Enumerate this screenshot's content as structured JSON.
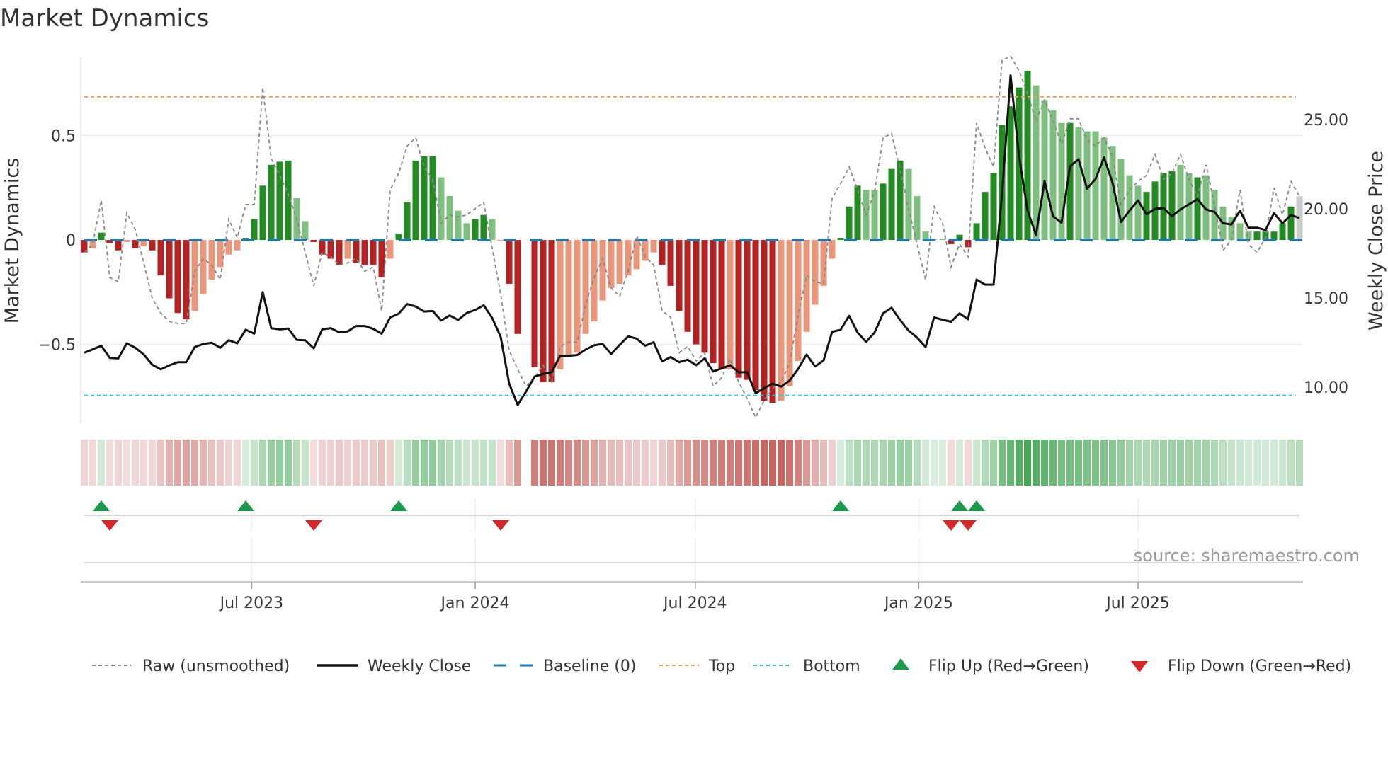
{
  "chart_data": {
    "type": "bar",
    "title": "Market Dynamics",
    "ylabel": "Market Dynamics",
    "y2label": "Weekly Close Price",
    "ylim": [
      -0.88,
      0.9
    ],
    "y2lim": [
      8.6,
      29.2
    ],
    "yticks": [
      {
        "value": 0.5,
        "label": "0.5"
      },
      {
        "value": 0,
        "label": "0"
      },
      {
        "value": -0.5,
        "label": "−0.5"
      }
    ],
    "y2ticks": [
      {
        "value": 25,
        "label": "25.00"
      },
      {
        "value": 20,
        "label": "20.00"
      },
      {
        "value": 15,
        "label": "15.00"
      },
      {
        "value": 10,
        "label": "10.00"
      }
    ],
    "xticks": [
      {
        "week": 20.7,
        "label": "Jul 2023"
      },
      {
        "week": 47.0,
        "label": "Jan 2024"
      },
      {
        "week": 72.9,
        "label": "Jul 2024"
      },
      {
        "week": 99.2,
        "label": "Jan 2025"
      },
      {
        "week": 125.0,
        "label": "Jul 2025"
      }
    ],
    "x_unit": "week index",
    "top_level": 0.685,
    "bottom_level": -0.745,
    "baseline": 0,
    "values": [
      -0.06,
      -0.04,
      0.035,
      -0.015,
      -0.05,
      -0.01,
      -0.04,
      -0.03,
      -0.05,
      -0.17,
      -0.28,
      -0.35,
      -0.38,
      -0.34,
      -0.26,
      -0.19,
      -0.13,
      -0.07,
      -0.05,
      0.01,
      0.1,
      0.26,
      0.36,
      0.375,
      0.38,
      0.2,
      0.09,
      -0.01,
      -0.07,
      -0.09,
      -0.12,
      -0.09,
      -0.11,
      -0.12,
      -0.12,
      -0.18,
      -0.09,
      0.03,
      0.18,
      0.38,
      0.4,
      0.4,
      0.3,
      0.21,
      0.14,
      0.08,
      0.1,
      0.12,
      0.1,
      -0.005,
      -0.21,
      -0.45,
      null,
      -0.61,
      -0.68,
      -0.68,
      -0.62,
      -0.56,
      -0.54,
      -0.45,
      -0.39,
      -0.29,
      -0.23,
      -0.21,
      -0.17,
      -0.14,
      -0.1,
      -0.06,
      -0.12,
      -0.22,
      -0.34,
      -0.44,
      -0.5,
      -0.54,
      -0.59,
      -0.62,
      -0.62,
      -0.66,
      -0.67,
      -0.72,
      -0.77,
      -0.78,
      -0.77,
      -0.7,
      -0.58,
      -0.44,
      -0.31,
      -0.22,
      -0.09,
      0.01,
      0.16,
      0.26,
      0.24,
      0.24,
      0.27,
      0.34,
      0.38,
      0.34,
      0.21,
      0.04,
      0.005,
      0.005,
      -0.02,
      0.025,
      -0.035,
      0.08,
      0.23,
      0.32,
      0.55,
      0.64,
      0.73,
      0.81,
      0.74,
      0.67,
      0.62,
      0.56,
      0.56,
      0.54,
      0.52,
      0.52,
      0.49,
      0.45,
      0.39,
      0.31,
      0.26,
      0.23,
      0.28,
      0.32,
      0.33,
      0.36,
      0.32,
      0.3,
      0.31,
      0.24,
      0.16,
      0.11,
      0.08,
      0.04,
      0.04,
      0.04,
      0.04,
      0.08,
      0.16,
      0.21
    ],
    "states": "RrGRRrRrRRRRRrrrrrrGGGGGGggRRRRrRRRRrGGGGGggggGGgrRR-RRRrrrrrrrrrrrrRRRRRRRRrRRRRRrrrrrrrGGGggGGGgggggRGRGGGGGGGggggGggggggggGGGGggGggggggGGGGG",
    "states_legend": {
      "R": "red strengthening",
      "r": "red fading",
      "G": "green strengthening",
      "g": "green fading"
    },
    "raw": [
      -0.06,
      -0.02,
      0.19,
      -0.18,
      -0.2,
      0.13,
      0.05,
      -0.11,
      -0.28,
      -0.35,
      -0.39,
      -0.4,
      -0.4,
      -0.15,
      -0.09,
      -0.12,
      -0.19,
      0.1,
      0.01,
      0.17,
      0.17,
      0.73,
      0.39,
      0.31,
      0.22,
      0.1,
      -0.06,
      -0.22,
      -0.06,
      -0.08,
      -0.12,
      -0.11,
      -0.09,
      -0.15,
      -0.13,
      -0.34,
      0.24,
      0.32,
      0.45,
      0.49,
      0.35,
      0.29,
      0.08,
      0.12,
      0.11,
      0.12,
      0.15,
      0.18,
      -0.04,
      -0.26,
      -0.53,
      -0.62,
      -0.7,
      -0.66,
      -0.6,
      -0.68,
      -0.51,
      -0.49,
      -0.49,
      -0.31,
      -0.18,
      -0.09,
      -0.23,
      -0.27,
      -0.15,
      0.02,
      -0.08,
      -0.12,
      -0.34,
      -0.37,
      -0.54,
      -0.51,
      -0.58,
      -0.54,
      -0.7,
      -0.66,
      -0.57,
      -0.68,
      -0.76,
      -0.85,
      -0.77,
      -0.71,
      -0.68,
      -0.59,
      -0.36,
      -0.17,
      -0.2,
      -0.21,
      0.2,
      0.27,
      0.35,
      0.24,
      0.12,
      0.23,
      0.49,
      0.51,
      0.34,
      0.15,
      -0.02,
      -0.19,
      0.16,
      0.08,
      -0.13,
      -0.02,
      -0.08,
      0.56,
      0.44,
      0.35,
      0.86,
      0.88,
      0.81,
      0.7,
      0.57,
      0.67,
      0.57,
      0.46,
      0.58,
      0.58,
      0.48,
      0.45,
      0.49,
      0.4,
      0.17,
      0.24,
      0.28,
      0.31,
      0.41,
      0.29,
      0.32,
      0.41,
      0.29,
      0.21,
      0.36,
      0.17,
      -0.05,
      0.0,
      0.24,
      -0.02,
      -0.06,
      0.01,
      0.25,
      0.12,
      0.28,
      0.21
    ],
    "close": [
      11.93,
      12.12,
      12.32,
      11.64,
      11.61,
      12.46,
      12.21,
      11.83,
      11.26,
      11.0,
      11.22,
      11.4,
      11.4,
      12.25,
      12.42,
      12.49,
      12.21,
      12.63,
      12.46,
      13.22,
      13.0,
      15.33,
      13.31,
      13.24,
      13.29,
      12.65,
      12.63,
      12.18,
      13.24,
      13.31,
      13.07,
      13.13,
      13.43,
      13.43,
      13.27,
      13.0,
      13.91,
      14.12,
      14.66,
      14.52,
      14.24,
      14.27,
      13.74,
      14.02,
      13.77,
      14.16,
      14.33,
      14.59,
      13.88,
      12.82,
      10.2,
      9.0,
      9.77,
      10.6,
      10.74,
      10.84,
      11.76,
      11.76,
      11.8,
      12.11,
      12.35,
      12.42,
      11.86,
      12.37,
      12.85,
      12.72,
      12.32,
      12.52,
      11.44,
      11.69,
      11.4,
      11.54,
      11.23,
      11.61,
      10.88,
      11.05,
      11.23,
      10.84,
      10.84,
      9.66,
      9.94,
      10.2,
      10.03,
      10.37,
      11.02,
      11.83,
      11.16,
      11.5,
      13.1,
      13.22,
      14.0,
      13.06,
      12.54,
      13.06,
      14.14,
      14.45,
      13.77,
      13.17,
      12.78,
      12.25,
      13.91,
      13.78,
      13.67,
      14.14,
      13.81,
      16.03,
      15.75,
      15.75,
      20.82,
      27.48,
      22.95,
      19.9,
      18.53,
      21.56,
      19.58,
      19.22,
      22.38,
      22.78,
      21.13,
      21.67,
      22.88,
      21.46,
      19.26,
      19.9,
      20.47,
      19.69,
      20.0,
      20.04,
      19.58,
      19.97,
      20.25,
      20.54,
      19.97,
      19.83,
      19.19,
      19.12,
      19.9,
      18.94,
      18.94,
      18.81,
      19.76,
      19.19,
      19.65,
      19.48
    ],
    "flip_up_weeks": [
      3,
      20,
      38,
      90,
      104,
      106
    ],
    "flip_down_weeks": [
      4,
      28,
      50,
      103,
      105
    ],
    "legend": {
      "placement": "bottom",
      "raw": "Raw (unsmoothed)",
      "close": "Weekly Close",
      "baseline": "Baseline (0)",
      "top": "Top",
      "bottom": "Bottom",
      "flip_up": "Flip Up (Red→Green)",
      "flip_down": "Flip Down (Green→Red)"
    },
    "source": "source: sharemaestro.com",
    "colors": {
      "R": "#b22222",
      "r": "#e9967a",
      "G": "#228b22",
      "g": "#7fbf7f",
      "strip_red": "#c45a55",
      "strip_green": "#3fa650",
      "raw": "#888888",
      "close": "#111111",
      "baseline": "#1f77b4",
      "top": "#f0a050",
      "bottom": "#2ec4d6",
      "flip_up": "#1a9a4a",
      "flip_down": "#d62728",
      "grid": "#ececec"
    }
  }
}
